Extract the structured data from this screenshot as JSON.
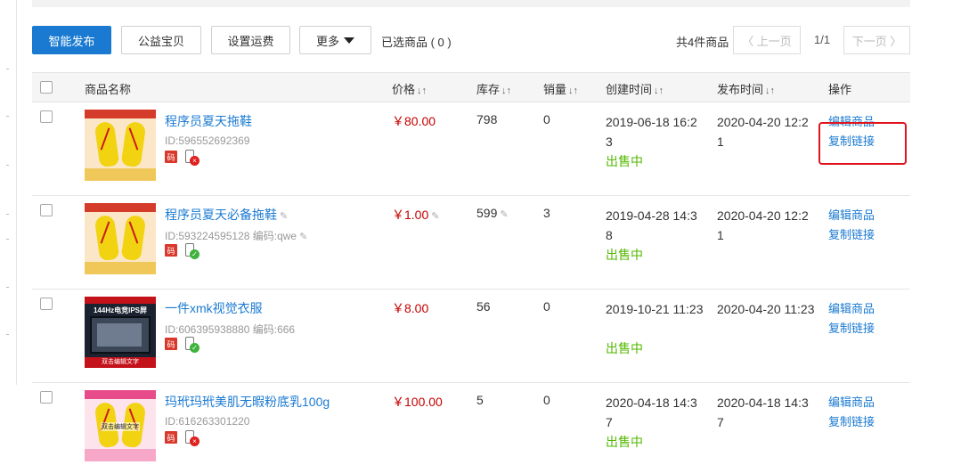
{
  "toolbar": {
    "smart_publish": "智能发布",
    "charity": "公益宝贝",
    "shipping": "设置运费",
    "more": "更多",
    "selected": "已选商品 ( 0 )"
  },
  "pager": {
    "total": "共4件商品",
    "prev": "〈 上一页",
    "page": "1/1",
    "next": "下一页 〉"
  },
  "columns": {
    "name": "商品名称",
    "price": "价格",
    "stock": "库存",
    "sales": "销量",
    "created": "创建时间",
    "published": "发布时间",
    "ops": "操作",
    "sort_icon": "↓↑"
  },
  "products": [
    {
      "title": "程序员夏天拖鞋",
      "id_text": "ID:596552692369",
      "price": "￥80.00",
      "stock": "798",
      "sales": "0",
      "created": "2019-06-18 16:23",
      "published": "2020-04-20 12:21",
      "status": "出售中",
      "edit": "编辑商品",
      "copy": "复制链接",
      "code_badge": "码",
      "phone_status": "×"
    },
    {
      "title": "程序员夏天必备拖鞋",
      "id_text": "ID:593224595128 编码:qwe",
      "price": "￥1.00",
      "stock": "599",
      "sales": "3",
      "created": "2019-04-28 14:38",
      "published": "2020-04-20 12:21",
      "status": "出售中",
      "edit": "编辑商品",
      "copy": "复制链接",
      "code_badge": "码",
      "phone_status": "✓"
    },
    {
      "title": "一件xmk视觉衣服",
      "id_text": "ID:606395938880 编码:666",
      "price": "￥8.00",
      "stock": "56",
      "sales": "0",
      "created": "2019-10-21 11:23",
      "published": "2020-04-20 11:23",
      "status": "出售中",
      "edit": "编辑商品",
      "copy": "复制链接",
      "code_badge": "码",
      "phone_status": "✓",
      "image_text": "144Hz电竞IPS屏",
      "image_banner": "双击编辑文字"
    },
    {
      "title": "玛玳玛玳美肌无暇粉底乳100g",
      "id_text": "ID:616263301220",
      "price": "￥100.00",
      "stock": "5",
      "sales": "0",
      "created": "2020-04-18 14:37",
      "published": "2020-04-18 14:37",
      "status": "出售中",
      "edit": "编辑商品",
      "copy": "复制链接",
      "code_badge": "码",
      "phone_status": "×",
      "image_text": "双击编辑文字"
    }
  ],
  "colors": {
    "primary": "#1a7ad1",
    "price": "#c40000",
    "status_on_sale": "#52b800",
    "highlight": "#e0141e"
  }
}
